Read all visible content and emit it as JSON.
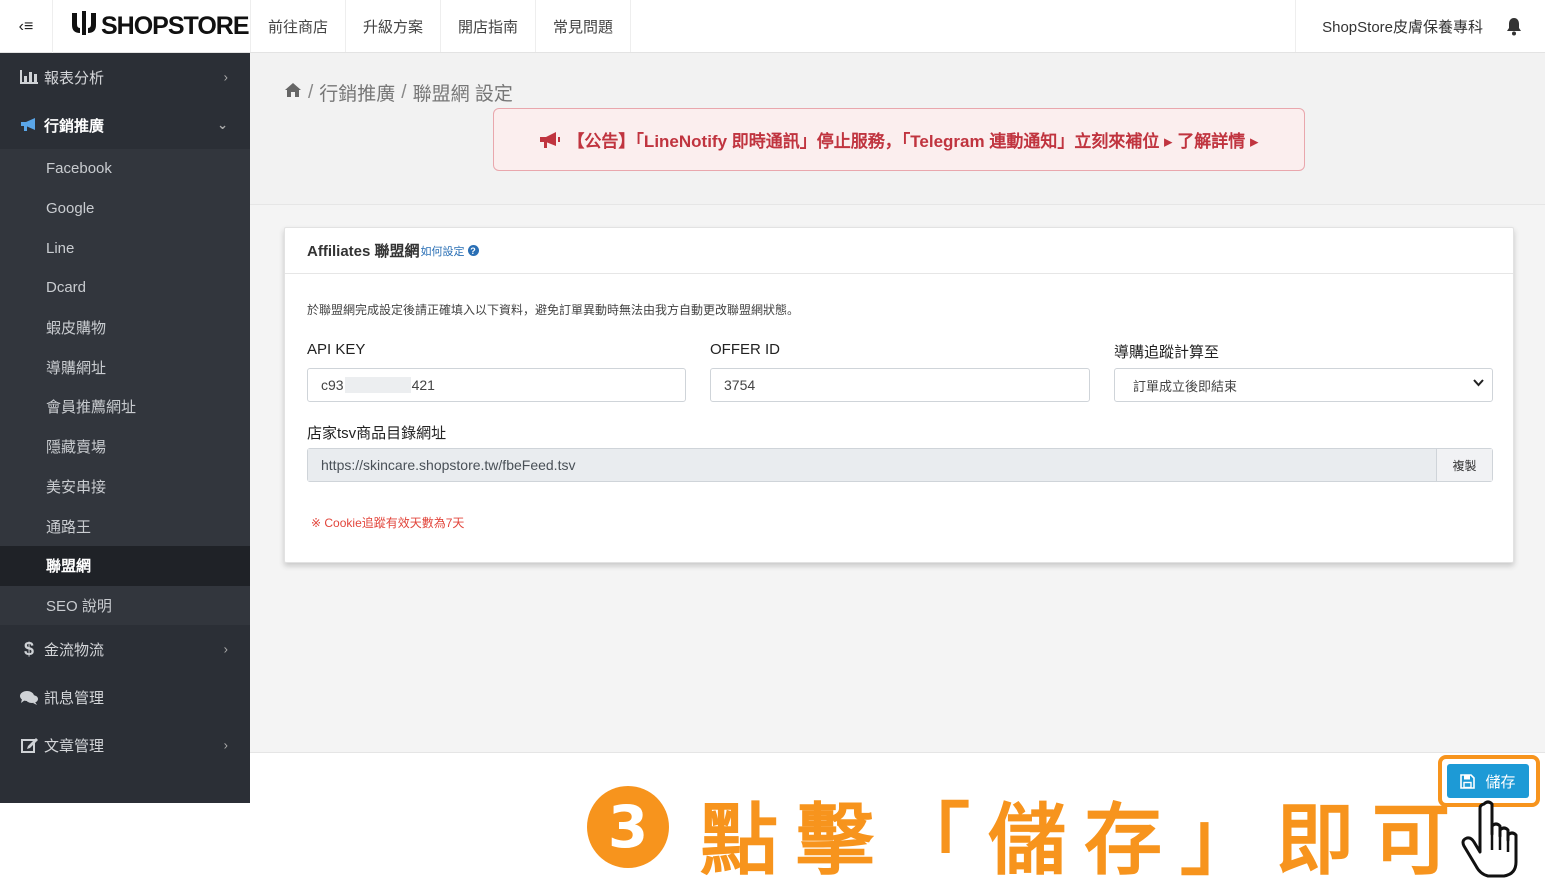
{
  "topbar": {
    "toggle_label": "‹≡",
    "logo_text": "SHOPSTORE",
    "nav": [
      "前往商店",
      "升級方案",
      "開店指南",
      "常見問題"
    ],
    "store_name": "ShopStore皮膚保養專科"
  },
  "sidebar": {
    "sections": [
      {
        "label": "報表分析",
        "icon": "bar-chart-icon",
        "chevron": "›"
      },
      {
        "label": "行銷推廣",
        "icon": "bullhorn-icon",
        "chevron": "⌄"
      }
    ],
    "sub_items": [
      "Facebook",
      "Google",
      "Line",
      "Dcard",
      "蝦皮購物",
      "導購網址",
      "會員推薦網址",
      "隱藏賣場",
      "美安串接",
      "通路王",
      "聯盟網",
      "SEO 說明"
    ],
    "bottom_sections": [
      {
        "label": "金流物流",
        "icon": "dollar-icon",
        "chevron": "›"
      },
      {
        "label": "訊息管理",
        "icon": "comments-icon",
        "chevron": ""
      },
      {
        "label": "文章管理",
        "icon": "edit-icon",
        "chevron": "›"
      }
    ]
  },
  "breadcrumb": {
    "parts": [
      "行銷推廣",
      "聯盟網 設定"
    ],
    "sep": "/"
  },
  "notice": {
    "text": "【公告】「LineNotify 即時通訊」停止服務，「Telegram 連動通知」立刻來補位 ▸ 了解詳情 ▸"
  },
  "card": {
    "title": "Affiliates 聯盟網",
    "howto": "如何設定",
    "description": "於聯盟網完成設定後請正確填入以下資料，避免訂單異動時無法由我方自動更改聯盟網狀態。",
    "api_key_label": "API KEY",
    "api_key_prefix": "c93",
    "api_key_suffix": "421",
    "offer_id_label": "OFFER ID",
    "offer_id_value": "3754",
    "tracking_label": "導購追蹤計算至",
    "tracking_value": "訂單成立後即結束",
    "tsv_label": "店家tsv商品目錄網址",
    "tsv_url": "https://skincare.shopstore.tw/fbeFeed.tsv",
    "copy_label": "複製",
    "cookie_note": "※ Cookie追蹤有效天數為7天"
  },
  "save_button": {
    "label": "儲存"
  },
  "annotation": {
    "step_number": "3",
    "text": "點擊「儲存」即可！"
  },
  "colors": {
    "sidebar_bg": "#2b2f36",
    "accent_orange": "#f7941d",
    "save_blue": "#1d9ad6",
    "notice_red": "#c0343f"
  }
}
